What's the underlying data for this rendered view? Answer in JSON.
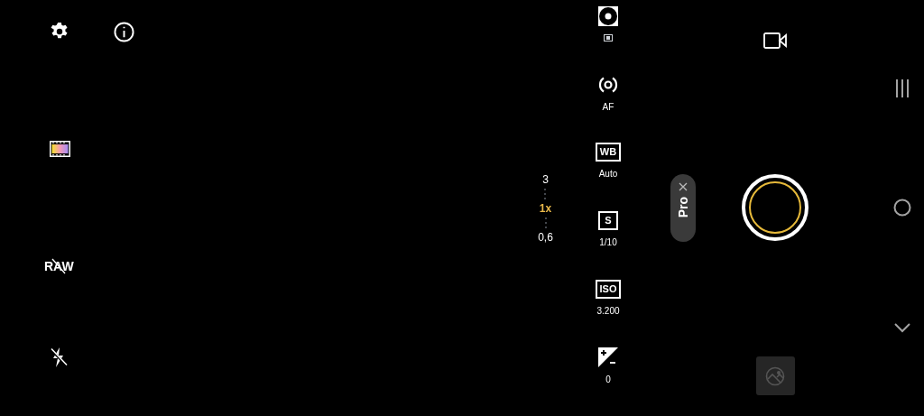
{
  "raw": {
    "label": "RAW",
    "on": false
  },
  "zoom_levels": [
    {
      "label": "3",
      "selected": false
    },
    {
      "label": "1x",
      "selected": true
    },
    {
      "label": "0,6",
      "selected": false
    }
  ],
  "pro_controls": [
    {
      "kind": "metering"
    },
    {
      "kind": "af",
      "value": "AF"
    },
    {
      "kind": "badge",
      "badge": "WB",
      "value": "Auto"
    },
    {
      "kind": "badge",
      "badge": "S",
      "value": "1/10"
    },
    {
      "kind": "badge",
      "badge": "ISO",
      "value": "3.200"
    },
    {
      "kind": "ev",
      "value": "0"
    }
  ],
  "mode_pill": {
    "label": "Pro"
  }
}
